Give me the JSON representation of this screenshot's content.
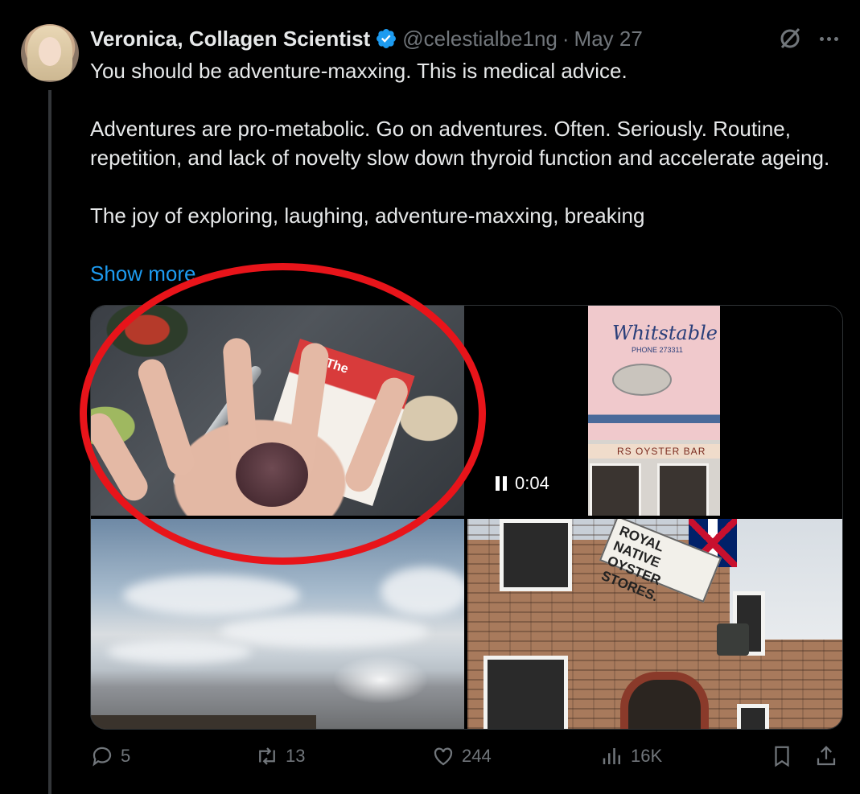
{
  "author": {
    "name": "Veronica, Collagen Scientist",
    "handle": "@celestialbe1ng",
    "separator": "·",
    "date": "May 27"
  },
  "tweet": {
    "line1": "You should be adventure-maxxing. This is medical advice.",
    "para2": "Adventures are pro-metabolic. Go on adventures. Often. Seriously. Routine, repetition, and lack of novelty slow down thyroid function and accelerate ageing.",
    "para3": "The joy of exploring, laughing, adventure-maxxing, breaking",
    "show_more": "Show more"
  },
  "media": {
    "video_time": "0:04",
    "video_sign_text": "Whitstable",
    "video_phone_text": "PHONE 273311",
    "video_bar_text": "RS   OYSTER BAR",
    "newspaper_text": "The",
    "building_sign": "ROYAL NATIVE OYSTER STORES."
  },
  "actions": {
    "replies": "5",
    "reposts": "13",
    "likes": "244",
    "views": "16K"
  },
  "colors": {
    "background": "#000000",
    "text": "#e7e9ea",
    "muted": "#71767b",
    "link": "#1d9bf0",
    "annotation": "#e8141a"
  }
}
